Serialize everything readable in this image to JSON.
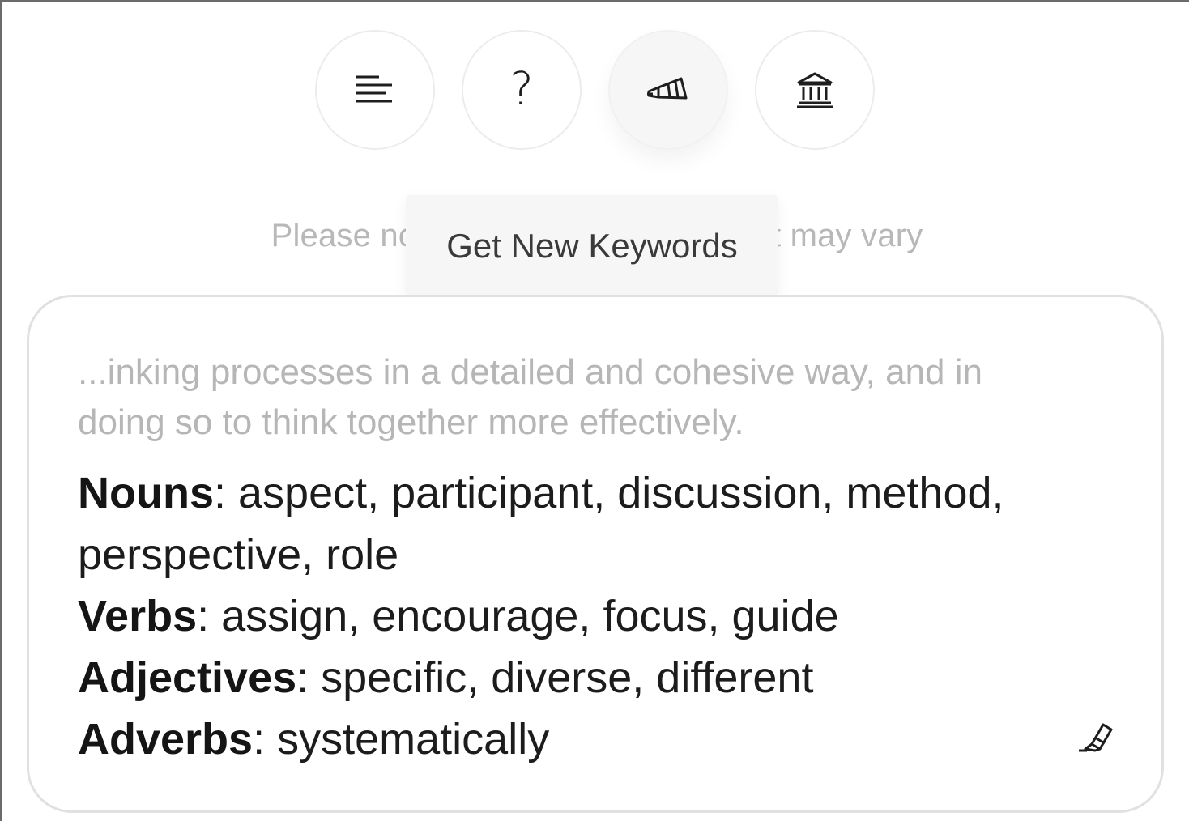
{
  "toolbar": {
    "buttons": [
      {
        "icon": "text-lines-icon"
      },
      {
        "icon": "help-icon",
        "glyph": "?"
      },
      {
        "icon": "megaphone-icon"
      },
      {
        "icon": "institution-icon"
      }
    ]
  },
  "tooltip": {
    "text": "Get New Keywords"
  },
  "note": {
    "text": "Please note that the generated text may vary"
  },
  "card": {
    "context": "...inking processes in a detailed and cohesive way, and in doing so to think together more effectively.",
    "keywords": {
      "nouns": {
        "label": "Nouns",
        "sep": ":",
        "words": " aspect, participant, discussion, method, perspective, role"
      },
      "verbs": {
        "label": "Verbs",
        "sep": ":",
        "words": " assign, encourage, focus, guide"
      },
      "adjectives": {
        "label": "Adjectives",
        "sep": ":",
        "words": " specific, diverse, different"
      },
      "adverbs": {
        "label": "Adverbs",
        "sep": ":",
        "words": " systematically"
      }
    },
    "highlight_icon": "highlighter-icon"
  },
  "colors": {
    "text_dark": "#1c1c1c",
    "text_muted": "#b6b6b6",
    "border": "#e1e1e1",
    "tooltip_bg": "#f6f6f6"
  }
}
